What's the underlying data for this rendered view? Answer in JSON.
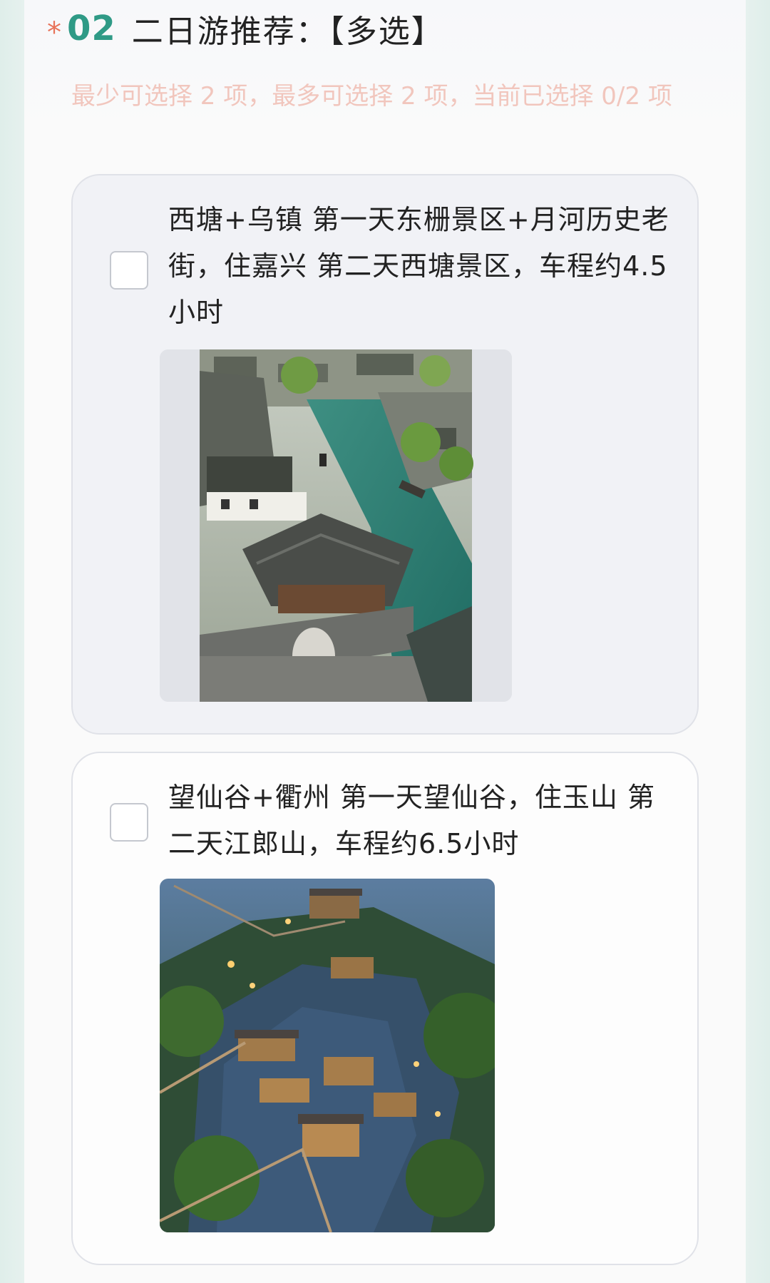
{
  "question": {
    "required_mark": "*",
    "number": "02",
    "title": "二日游推荐：【多选】",
    "hint": "最少可选择 2 项，最多可选择 2 项，当前已选择 0/2 项"
  },
  "options": [
    {
      "label": "西塘+乌镇 第一天东栅景区+月河历史老街，住嘉兴 第二天西塘景区，车程约4.5小时",
      "checked": false,
      "image": "water-town-canal-photo"
    },
    {
      "label": "望仙谷+衢州 第一天望仙谷，住玉山 第二天江郎山，车程约6.5小时",
      "checked": false,
      "image": "cliffside-village-photo"
    }
  ],
  "colors": {
    "accent_number": "#2f9a86",
    "required_star": "#e8735a",
    "hint_text": "#f1c6bd"
  }
}
